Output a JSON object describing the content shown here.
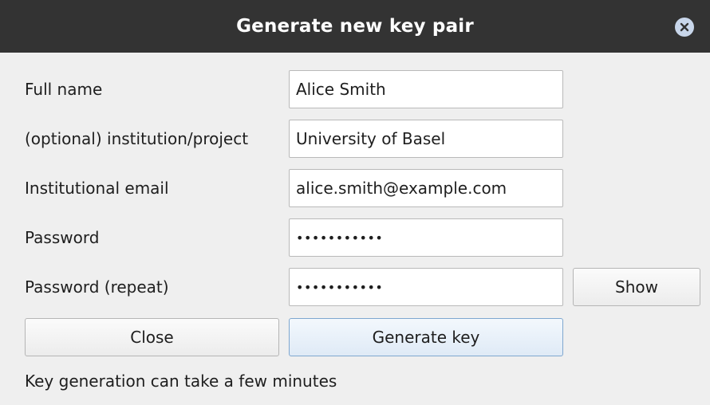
{
  "window": {
    "title": "Generate new key pair"
  },
  "form": {
    "full_name": {
      "label": "Full name",
      "value": "Alice Smith"
    },
    "institution": {
      "label": "(optional) institution/project",
      "value": "University of Basel"
    },
    "email": {
      "label": "Institutional email",
      "value": "alice.smith@example.com"
    },
    "password": {
      "label": "Password",
      "masked_value": "•••••••••••"
    },
    "password_repeat": {
      "label": "Password (repeat)",
      "masked_value": "•••••••••••"
    }
  },
  "buttons": {
    "show": "Show",
    "close": "Close",
    "generate": "Generate key"
  },
  "status": "Key generation can take a few minutes",
  "icons": {
    "title_close": "close-circle-icon"
  },
  "colors": {
    "titlebar": "#333333",
    "background": "#efefef",
    "primary_border": "#7fa7cf"
  }
}
